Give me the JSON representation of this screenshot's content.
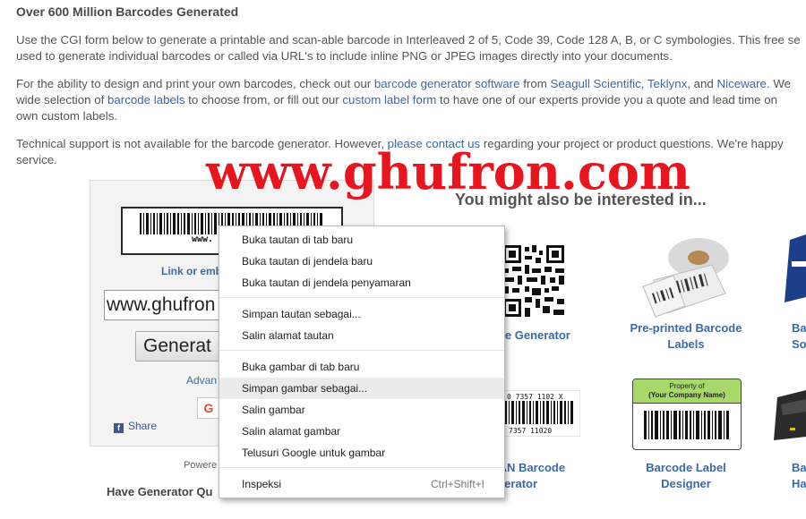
{
  "heading": "Over 600 Million Barcodes Generated",
  "para1": {
    "line1": "Use the CGI form below to generate a printable and scan-able barcode in Interleaved 2 of 5, Code 39, Code 128 A, B, or C symbologies. This free se",
    "line2": "used to generate individual barcodes or called via URL's to include inline PNG or JPEG images directly into your documents."
  },
  "para2": {
    "l1_a": "For the ability to design and print your own barcodes, check out our ",
    "l1_link1": "barcode generator software",
    "l1_b": " from ",
    "l1_link2": "Seagull Scientific",
    "l1_c": ", ",
    "l1_link3": "Teklynx",
    "l1_d": ", and ",
    "l1_link4": "Niceware",
    "l1_e": ". We",
    "l2_a": "wide selection of ",
    "l2_link1": "barcode labels",
    "l2_b": " to choose from, or fill out our ",
    "l2_link2": "custom label form",
    "l2_c": " to have one of our experts provide you a quote and lead time on",
    "l3": "own custom labels."
  },
  "para3": {
    "l1_a": "Technical support is not available for the barcode generator. However, ",
    "l1_link": "please contact us",
    "l1_b": " regarding your project or product questions. We're happy",
    "l2": "service."
  },
  "watermark": "www.ghufron.com",
  "generator": {
    "barcode_text": "www.",
    "embed_label": "Link or emb",
    "input_value": "www.ghufron",
    "button_label": "Generat",
    "advanced": "Advan",
    "gplus": "G",
    "share": "Share",
    "powered": "Powere",
    "have_generator": "Have Generator Qu"
  },
  "interest": {
    "title": "You might also be interested in...",
    "cards": [
      {
        "label_line1": "ode Generator",
        "label_line2": ""
      },
      {
        "label_line1": "Pre-printed Barcode",
        "label_line2": "Labels"
      },
      {
        "label_line1": "Ba",
        "label_line2": "So"
      },
      {
        "label_line1": "EAN Barcode",
        "label_line2": "enerator"
      },
      {
        "label_line1": "Barcode Label",
        "label_line2": "Designer"
      },
      {
        "label_line1": "Ba",
        "label_line2": "Ha"
      }
    ],
    "ean_top": "0 7357 1102 X",
    "ean_bottom": "7357 11020",
    "property_line1": "Property of",
    "property_line2": "(Your Company Name)"
  },
  "context_menu": {
    "items": [
      "Buka tautan di tab baru",
      "Buka tautan di jendela baru",
      "Buka tautan di jendela penyamaran",
      "Simpan tautan sebagai...",
      "Salin alamat tautan",
      "Buka gambar di tab baru",
      "Simpan gambar sebagai...",
      "Salin gambar",
      "Salin alamat gambar",
      "Telusuri Google untuk gambar",
      "Inspeksi"
    ],
    "shortcut": "Ctrl+Shift+I"
  },
  "colors": {
    "link": "#3b6aa6",
    "watermark": "#e8141e",
    "menu_highlight": "#ebebeb",
    "property_label_bg": "#a6d86a"
  }
}
